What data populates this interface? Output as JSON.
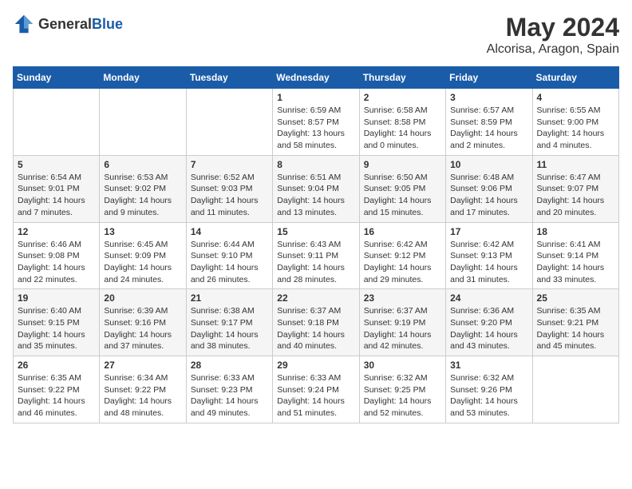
{
  "logo": {
    "text_general": "General",
    "text_blue": "Blue"
  },
  "title": "May 2024",
  "location": "Alcorisa, Aragon, Spain",
  "days_of_week": [
    "Sunday",
    "Monday",
    "Tuesday",
    "Wednesday",
    "Thursday",
    "Friday",
    "Saturday"
  ],
  "weeks": [
    [
      {
        "day": "",
        "info": ""
      },
      {
        "day": "",
        "info": ""
      },
      {
        "day": "",
        "info": ""
      },
      {
        "day": "1",
        "info": "Sunrise: 6:59 AM\nSunset: 8:57 PM\nDaylight: 13 hours\nand 58 minutes."
      },
      {
        "day": "2",
        "info": "Sunrise: 6:58 AM\nSunset: 8:58 PM\nDaylight: 14 hours\nand 0 minutes."
      },
      {
        "day": "3",
        "info": "Sunrise: 6:57 AM\nSunset: 8:59 PM\nDaylight: 14 hours\nand 2 minutes."
      },
      {
        "day": "4",
        "info": "Sunrise: 6:55 AM\nSunset: 9:00 PM\nDaylight: 14 hours\nand 4 minutes."
      }
    ],
    [
      {
        "day": "5",
        "info": "Sunrise: 6:54 AM\nSunset: 9:01 PM\nDaylight: 14 hours\nand 7 minutes."
      },
      {
        "day": "6",
        "info": "Sunrise: 6:53 AM\nSunset: 9:02 PM\nDaylight: 14 hours\nand 9 minutes."
      },
      {
        "day": "7",
        "info": "Sunrise: 6:52 AM\nSunset: 9:03 PM\nDaylight: 14 hours\nand 11 minutes."
      },
      {
        "day": "8",
        "info": "Sunrise: 6:51 AM\nSunset: 9:04 PM\nDaylight: 14 hours\nand 13 minutes."
      },
      {
        "day": "9",
        "info": "Sunrise: 6:50 AM\nSunset: 9:05 PM\nDaylight: 14 hours\nand 15 minutes."
      },
      {
        "day": "10",
        "info": "Sunrise: 6:48 AM\nSunset: 9:06 PM\nDaylight: 14 hours\nand 17 minutes."
      },
      {
        "day": "11",
        "info": "Sunrise: 6:47 AM\nSunset: 9:07 PM\nDaylight: 14 hours\nand 20 minutes."
      }
    ],
    [
      {
        "day": "12",
        "info": "Sunrise: 6:46 AM\nSunset: 9:08 PM\nDaylight: 14 hours\nand 22 minutes."
      },
      {
        "day": "13",
        "info": "Sunrise: 6:45 AM\nSunset: 9:09 PM\nDaylight: 14 hours\nand 24 minutes."
      },
      {
        "day": "14",
        "info": "Sunrise: 6:44 AM\nSunset: 9:10 PM\nDaylight: 14 hours\nand 26 minutes."
      },
      {
        "day": "15",
        "info": "Sunrise: 6:43 AM\nSunset: 9:11 PM\nDaylight: 14 hours\nand 28 minutes."
      },
      {
        "day": "16",
        "info": "Sunrise: 6:42 AM\nSunset: 9:12 PM\nDaylight: 14 hours\nand 29 minutes."
      },
      {
        "day": "17",
        "info": "Sunrise: 6:42 AM\nSunset: 9:13 PM\nDaylight: 14 hours\nand 31 minutes."
      },
      {
        "day": "18",
        "info": "Sunrise: 6:41 AM\nSunset: 9:14 PM\nDaylight: 14 hours\nand 33 minutes."
      }
    ],
    [
      {
        "day": "19",
        "info": "Sunrise: 6:40 AM\nSunset: 9:15 PM\nDaylight: 14 hours\nand 35 minutes."
      },
      {
        "day": "20",
        "info": "Sunrise: 6:39 AM\nSunset: 9:16 PM\nDaylight: 14 hours\nand 37 minutes."
      },
      {
        "day": "21",
        "info": "Sunrise: 6:38 AM\nSunset: 9:17 PM\nDaylight: 14 hours\nand 38 minutes."
      },
      {
        "day": "22",
        "info": "Sunrise: 6:37 AM\nSunset: 9:18 PM\nDaylight: 14 hours\nand 40 minutes."
      },
      {
        "day": "23",
        "info": "Sunrise: 6:37 AM\nSunset: 9:19 PM\nDaylight: 14 hours\nand 42 minutes."
      },
      {
        "day": "24",
        "info": "Sunrise: 6:36 AM\nSunset: 9:20 PM\nDaylight: 14 hours\nand 43 minutes."
      },
      {
        "day": "25",
        "info": "Sunrise: 6:35 AM\nSunset: 9:21 PM\nDaylight: 14 hours\nand 45 minutes."
      }
    ],
    [
      {
        "day": "26",
        "info": "Sunrise: 6:35 AM\nSunset: 9:22 PM\nDaylight: 14 hours\nand 46 minutes."
      },
      {
        "day": "27",
        "info": "Sunrise: 6:34 AM\nSunset: 9:22 PM\nDaylight: 14 hours\nand 48 minutes."
      },
      {
        "day": "28",
        "info": "Sunrise: 6:33 AM\nSunset: 9:23 PM\nDaylight: 14 hours\nand 49 minutes."
      },
      {
        "day": "29",
        "info": "Sunrise: 6:33 AM\nSunset: 9:24 PM\nDaylight: 14 hours\nand 51 minutes."
      },
      {
        "day": "30",
        "info": "Sunrise: 6:32 AM\nSunset: 9:25 PM\nDaylight: 14 hours\nand 52 minutes."
      },
      {
        "day": "31",
        "info": "Sunrise: 6:32 AM\nSunset: 9:26 PM\nDaylight: 14 hours\nand 53 minutes."
      },
      {
        "day": "",
        "info": ""
      }
    ]
  ]
}
